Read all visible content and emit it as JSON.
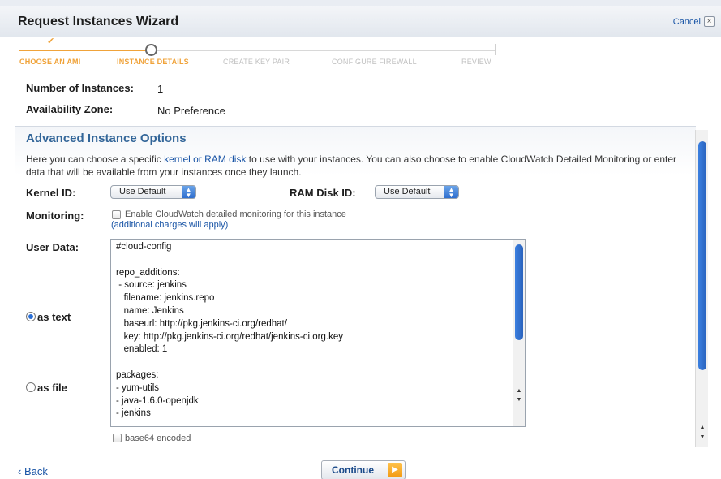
{
  "window": {
    "title": "Request Instances Wizard",
    "cancel_label": "Cancel",
    "close_icon": "×"
  },
  "steps": [
    {
      "label": "CHOOSE AN AMI",
      "state": "done"
    },
    {
      "label": "INSTANCE DETAILS",
      "state": "current"
    },
    {
      "label": "CREATE KEY PAIR",
      "state": "todo"
    },
    {
      "label": "CONFIGURE FIREWALL",
      "state": "todo"
    },
    {
      "label": "REVIEW",
      "state": "todo"
    }
  ],
  "details": {
    "instances_label": "Number of Instances:",
    "instances_value": "1",
    "zone_label": "Availability Zone:",
    "zone_value": "No Preference"
  },
  "advanced": {
    "title": "Advanced Instance Options",
    "desc_part1": "Here you can choose a specific ",
    "desc_link": "kernel or RAM disk",
    "desc_part2": " to use with your instances. You can also choose to enable CloudWatch Detailed Monitoring or enter data that will be available from your instances once they launch.",
    "kernel_label": "Kernel ID:",
    "kernel_value": "Use Default",
    "ramdisk_label": "RAM Disk ID:",
    "ramdisk_value": "Use Default",
    "monitoring_label": "Monitoring:",
    "monitoring_text": "Enable CloudWatch detailed monitoring for this instance",
    "monitoring_note": "(additional charges will apply)",
    "user_data_label": "User Data:",
    "as_text_label": "as text",
    "as_file_label": "as file",
    "as_text_selected": true,
    "user_data_text": "#cloud-config\n\nrepo_additions:\n - source: jenkins\n   filename: jenkins.repo\n   name: Jenkins\n   baseurl: http://pkg.jenkins-ci.org/redhat/\n   key: http://pkg.jenkins-ci.org/redhat/jenkins-ci.org.key\n   enabled: 1\n\npackages:\n- yum-utils\n- java-1.6.0-openjdk\n- jenkins",
    "base64_label": "base64 encoded"
  },
  "footer": {
    "back_label": "‹ Back",
    "continue_label": "Continue"
  },
  "colors": {
    "accent_orange": "#f0a33a",
    "link_blue": "#1a55a6",
    "heading_blue": "#336699"
  }
}
